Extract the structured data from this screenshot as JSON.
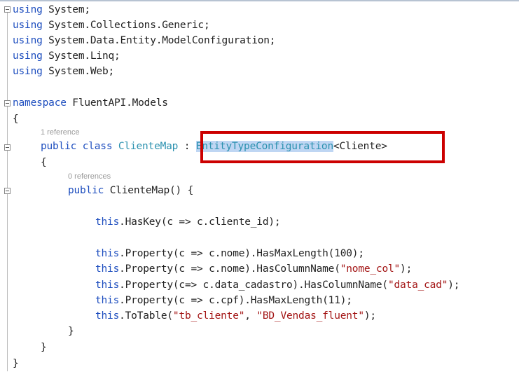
{
  "editor": {
    "usings": [
      {
        "keyword": "using",
        "ns": " System;"
      },
      {
        "keyword": "using",
        "ns": " System.Collections.Generic;"
      },
      {
        "keyword": "using",
        "ns": " System.Data.Entity.ModelConfiguration;"
      },
      {
        "keyword": "using",
        "ns": " System.Linq;"
      },
      {
        "keyword": "using",
        "ns": " System.Web;"
      }
    ],
    "namespace_keyword": "namespace",
    "namespace_name": " FluentAPI.Models",
    "open_brace": "{",
    "close_brace": "}",
    "class_refs": "1 reference",
    "class_mods": "public class ",
    "class_name": "ClienteMap",
    "class_colon": " : ",
    "base_type": "EntityTypeConfiguration",
    "base_generic": "<Cliente>",
    "ctor_refs": "0 references",
    "ctor_mods": "public ",
    "ctor_name": "ClienteMap() {",
    "code": {
      "haskey_this": "this",
      "haskey_rest": ".HasKey(c => c.cliente_id);",
      "p1_this": "this",
      "p1_rest": ".Property(c => c.nome).HasMaxLength(100);",
      "p2_this": "this",
      "p2_rest": ".Property(c => c.nome).HasColumnName(",
      "p2_str": "\"nome_col\"",
      "p2_end": ");",
      "p3_this": "this",
      "p3_rest": ".Property(c=> c.data_cadastro).HasColumnName(",
      "p3_str": "\"data_cad\"",
      "p3_end": ");",
      "p4_this": "this",
      "p4_rest": ".Property(c => c.cpf).HasMaxLength(11);",
      "t_this": "this",
      "t_rest": ".ToTable(",
      "t_str1": "\"tb_cliente\"",
      "t_comma": ", ",
      "t_str2": "\"BD_Vendas_fluent\"",
      "t_end": ");"
    },
    "colors": {
      "keyword": "#1f4fbf",
      "type": "#2b91af",
      "string": "#a31515",
      "highlight_box": "#cc0000",
      "selection": "#bfd6f3"
    }
  }
}
